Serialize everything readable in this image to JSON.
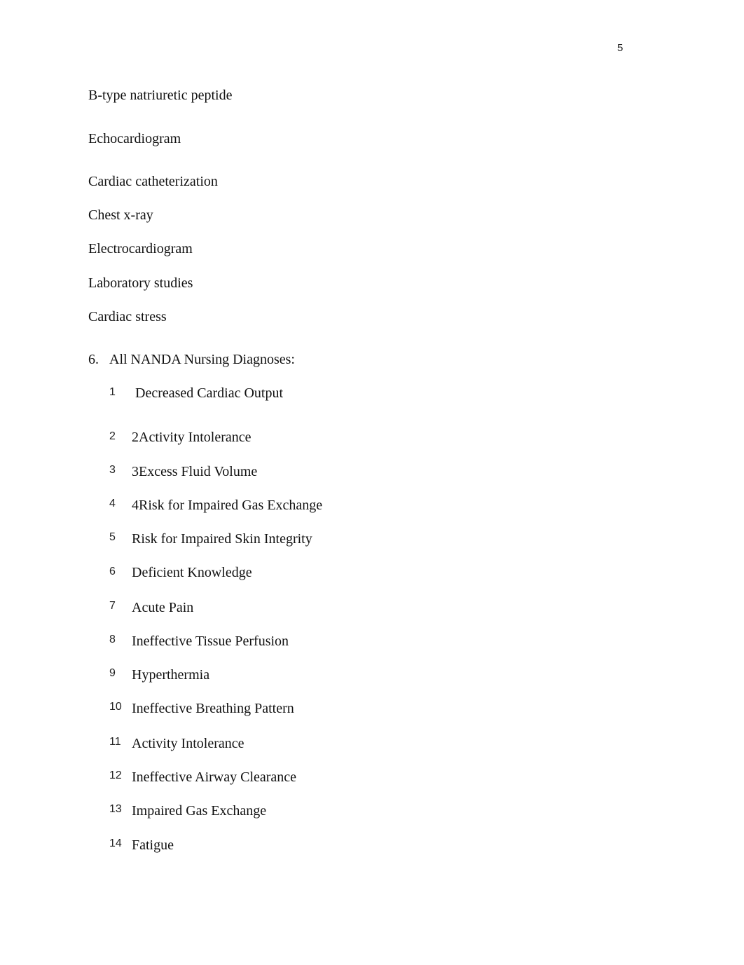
{
  "page_number": "5",
  "tests": [
    "B-type natriuretic peptide",
    "Echocardiogram",
    "Cardiac catheterization",
    "Chest x-ray",
    "Electrocardiogram",
    "Laboratory studies",
    "Cardiac stress"
  ],
  "section": {
    "number": "6.",
    "title": "All NANDA Nursing Diagnoses:"
  },
  "diagnoses": [
    {
      "num": "1",
      "text": " Decreased Cardiac Output"
    },
    {
      "num": "2",
      "text": "2Activity Intolerance"
    },
    {
      "num": "3",
      "text": "3Excess Fluid Volume"
    },
    {
      "num": "4",
      "text": "4Risk for Impaired Gas Exchange"
    },
    {
      "num": "5",
      "text": "Risk for Impaired Skin Integrity"
    },
    {
      "num": "6",
      "text": "Deficient Knowledge"
    },
    {
      "num": "7",
      "text": "Acute Pain"
    },
    {
      "num": "8",
      "text": "Ineffective Tissue Perfusion"
    },
    {
      "num": "9",
      "text": "Hyperthermia"
    },
    {
      "num": "10",
      "text": "Ineffective Breathing Pattern"
    },
    {
      "num": "11",
      "text": "Activity Intolerance"
    },
    {
      "num": "12",
      "text": "Ineffective Airway Clearance"
    },
    {
      "num": "13",
      "text": "Impaired Gas Exchange"
    },
    {
      "num": "14",
      "text": "Fatigue"
    }
  ]
}
